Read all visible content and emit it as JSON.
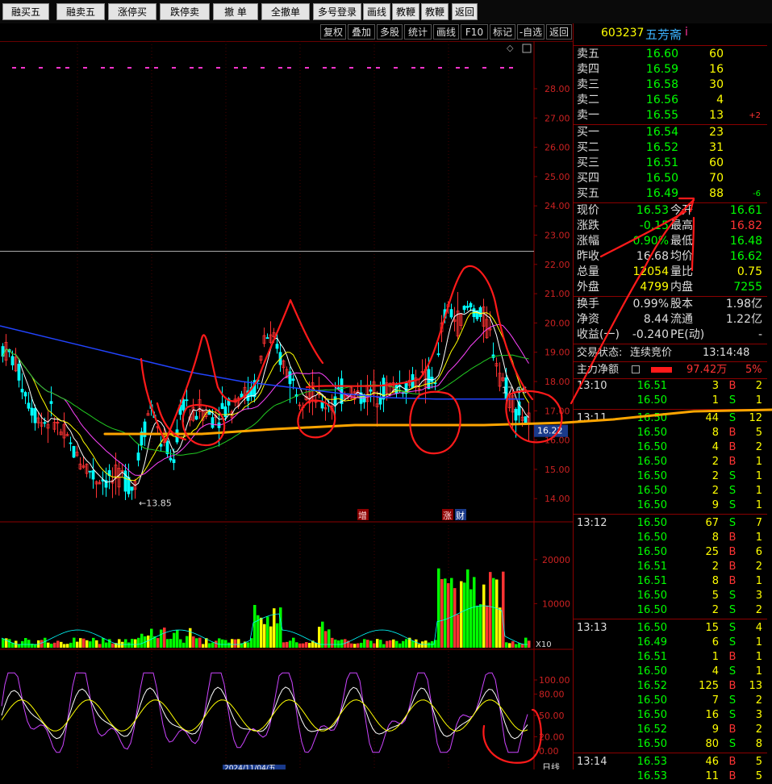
{
  "toolbar": {
    "buttons": [
      "融买五",
      "融卖五",
      "涨停买",
      "跌停卖",
      "撤 单",
      "全撤单",
      "多号登录",
      "画线",
      "教鞭A",
      "教鞭B",
      "返回"
    ]
  },
  "subbar": {
    "buttons": [
      "复权",
      "叠加",
      "多股",
      "统计",
      "画线",
      "F10",
      "标记",
      "-自选",
      "返回"
    ]
  },
  "chart": {
    "price_ticks": [
      "28.00",
      "27.00",
      "26.00",
      "25.00",
      "24.00",
      "23.00",
      "22.00",
      "21.00",
      "20.00",
      "19.00",
      "18.00",
      "17.00",
      "16.00",
      "15.00",
      "14.00"
    ],
    "low_label": "13.85",
    "high_label": "17.66",
    "current_price_label": "16.22",
    "volume_ticks": [
      "20000",
      "10000"
    ],
    "volume_unit": "X10",
    "indicator_ticks": [
      "100.00",
      "80.00",
      "50.00",
      "20.00",
      "0.00"
    ],
    "marker_zeng": "增",
    "marker_zhang": "涨",
    "marker_cai": "财",
    "date_label": "2024/11/04/五",
    "corner_label": "日线"
  },
  "panel": {
    "code": "603237",
    "name": "五芳斋",
    "info_icon": "i",
    "asks": [
      {
        "label": "卖五",
        "price": "16.60",
        "vol": "60",
        "chg": ""
      },
      {
        "label": "卖四",
        "price": "16.59",
        "vol": "16",
        "chg": ""
      },
      {
        "label": "卖三",
        "price": "16.58",
        "vol": "30",
        "chg": ""
      },
      {
        "label": "卖二",
        "price": "16.56",
        "vol": "4",
        "chg": ""
      },
      {
        "label": "卖一",
        "price": "16.55",
        "vol": "13",
        "chg": "+2"
      }
    ],
    "bids": [
      {
        "label": "买一",
        "price": "16.54",
        "vol": "23",
        "chg": ""
      },
      {
        "label": "买二",
        "price": "16.52",
        "vol": "31",
        "chg": ""
      },
      {
        "label": "买三",
        "price": "16.51",
        "vol": "60",
        "chg": ""
      },
      {
        "label": "买四",
        "price": "16.50",
        "vol": "70",
        "chg": ""
      },
      {
        "label": "买五",
        "price": "16.49",
        "vol": "88",
        "chg": "-6"
      }
    ],
    "quote": [
      {
        "l1": "现价",
        "v1": "16.53",
        "l2": "今开",
        "v2": "16.61"
      },
      {
        "l1": "涨跌",
        "v1": "-0.15",
        "l2": "最高",
        "v2": "16.82"
      },
      {
        "l1": "涨幅",
        "v1": "-0.90%",
        "l2": "最低",
        "v2": "16.48"
      },
      {
        "l1": "昨收",
        "v1": "16.68",
        "l2": "均价",
        "v2": "16.62"
      },
      {
        "l1": "总量",
        "v1": "12054",
        "l2": "量比",
        "v2": "0.75"
      },
      {
        "l1": "外盘",
        "v1": "4799",
        "l2": "内盘",
        "v2": "7255"
      }
    ],
    "stats": [
      {
        "l1": "换手",
        "v1": "0.99%",
        "l2": "股本",
        "v2": "1.98亿"
      },
      {
        "l1": "净资",
        "v1": "8.44",
        "l2": "流通",
        "v2": "1.22亿"
      },
      {
        "l1": "收益(一)",
        "v1": "-0.240",
        "l2": "PE(动)",
        "v2": "-"
      }
    ],
    "trade_status_label": "交易状态:",
    "trade_status": "连续竞价",
    "trade_time": "13:14:48",
    "main_flow_label": "主力净额",
    "main_flow_value": "97.42万",
    "main_flow_pct": "5%",
    "ticks": [
      {
        "t": "13:10",
        "p": "16.51",
        "v": "3",
        "s": "B",
        "n": "2"
      },
      {
        "t": "",
        "p": "16.50",
        "v": "1",
        "s": "S",
        "n": "1"
      },
      {
        "t": "13:11",
        "p": "16.50",
        "v": "44",
        "s": "S",
        "n": "12"
      },
      {
        "t": "",
        "p": "16.50",
        "v": "8",
        "s": "B",
        "n": "5"
      },
      {
        "t": "",
        "p": "16.50",
        "v": "4",
        "s": "B",
        "n": "2"
      },
      {
        "t": "",
        "p": "16.50",
        "v": "2",
        "s": "B",
        "n": "1"
      },
      {
        "t": "",
        "p": "16.50",
        "v": "2",
        "s": "S",
        "n": "1"
      },
      {
        "t": "",
        "p": "16.50",
        "v": "2",
        "s": "S",
        "n": "1"
      },
      {
        "t": "",
        "p": "16.50",
        "v": "9",
        "s": "S",
        "n": "1"
      },
      {
        "t": "13:12",
        "p": "16.50",
        "v": "67",
        "s": "S",
        "n": "7"
      },
      {
        "t": "",
        "p": "16.50",
        "v": "8",
        "s": "B",
        "n": "1"
      },
      {
        "t": "",
        "p": "16.50",
        "v": "25",
        "s": "B",
        "n": "6"
      },
      {
        "t": "",
        "p": "16.51",
        "v": "2",
        "s": "B",
        "n": "2"
      },
      {
        "t": "",
        "p": "16.51",
        "v": "8",
        "s": "B",
        "n": "1"
      },
      {
        "t": "",
        "p": "16.50",
        "v": "5",
        "s": "S",
        "n": "3"
      },
      {
        "t": "",
        "p": "16.50",
        "v": "2",
        "s": "S",
        "n": "2"
      },
      {
        "t": "13:13",
        "p": "16.50",
        "v": "15",
        "s": "S",
        "n": "4"
      },
      {
        "t": "",
        "p": "16.49",
        "v": "6",
        "s": "S",
        "n": "1"
      },
      {
        "t": "",
        "p": "16.51",
        "v": "1",
        "s": "B",
        "n": "1"
      },
      {
        "t": "",
        "p": "16.50",
        "v": "4",
        "s": "S",
        "n": "1"
      },
      {
        "t": "",
        "p": "16.52",
        "v": "125",
        "s": "B",
        "n": "13"
      },
      {
        "t": "",
        "p": "16.50",
        "v": "7",
        "s": "S",
        "n": "2"
      },
      {
        "t": "",
        "p": "16.50",
        "v": "16",
        "s": "S",
        "n": "3"
      },
      {
        "t": "",
        "p": "16.52",
        "v": "9",
        "s": "B",
        "n": "2"
      },
      {
        "t": "",
        "p": "16.50",
        "v": "80",
        "s": "S",
        "n": "8"
      },
      {
        "t": "13:14",
        "p": "16.53",
        "v": "46",
        "s": "B",
        "n": "5"
      },
      {
        "t": "",
        "p": "16.53",
        "v": "11",
        "s": "B",
        "n": "5"
      }
    ]
  },
  "colors": {
    "up": "#ff3333",
    "down": "#00ff00",
    "flat": "#dddddd",
    "cyan": "#00ffff",
    "yellow": "#ffff00",
    "annotation": "#ff1a1a",
    "support": "#ffa500"
  }
}
